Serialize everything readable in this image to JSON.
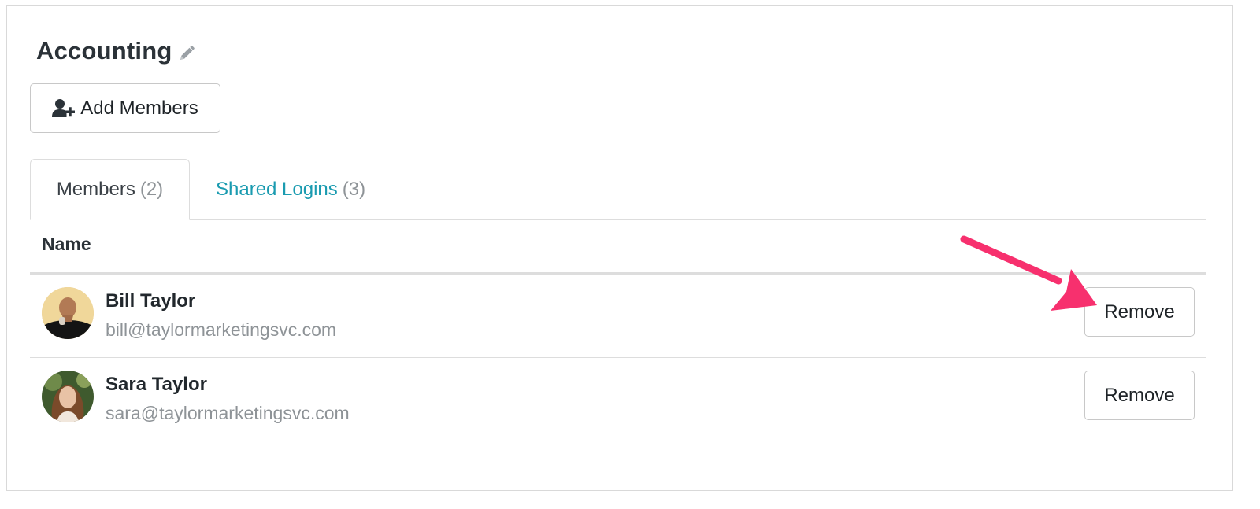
{
  "header": {
    "title": "Accounting",
    "edit_icon": "pencil-icon"
  },
  "toolbar": {
    "add_members_label": "Add Members",
    "add_members_icon": "user-plus-icon"
  },
  "tabs": [
    {
      "label": "Members",
      "count": "(2)",
      "active": true
    },
    {
      "label": "Shared Logins",
      "count": "(3)",
      "active": false
    }
  ],
  "table": {
    "column_header": "Name",
    "rows": [
      {
        "name": "Bill Taylor",
        "email": "bill@taylormarketingsvc.com",
        "action_label": "Remove"
      },
      {
        "name": "Sara Taylor",
        "email": "sara@taylormarketingsvc.com",
        "action_label": "Remove"
      }
    ]
  },
  "colors": {
    "link": "#1a9bb0",
    "annotation_arrow": "#f7306e",
    "muted_text": "#8e9397"
  }
}
